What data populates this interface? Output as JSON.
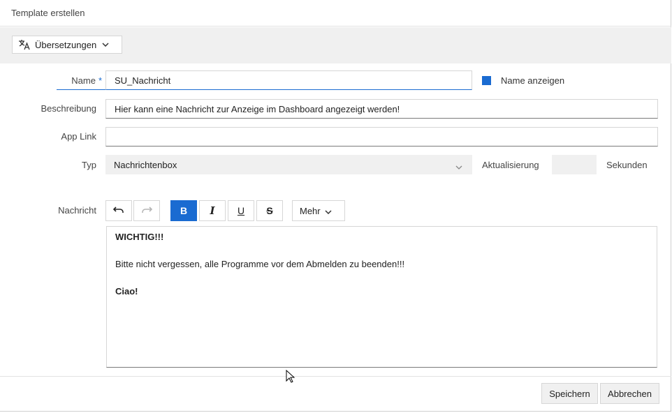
{
  "dialog": {
    "title": "Template erstellen"
  },
  "toolbar": {
    "translations_label": "Übersetzungen"
  },
  "form": {
    "name_label": "Name",
    "name_required_mark": "*",
    "name_value": "SU_Nachricht",
    "show_name_label": "Name anzeigen",
    "show_name_checked": true,
    "description_label": "Beschreibung",
    "description_value": "Hier kann eine Nachricht zur Anzeige im Dashboard angezeigt werden!",
    "app_link_label": "App Link",
    "app_link_value": "",
    "type_label": "Typ",
    "type_value": "Nachrichtenbox",
    "refresh_label": "Aktualisierung",
    "refresh_value": "",
    "seconds_label": "Sekunden",
    "message_label": "Nachricht"
  },
  "editor": {
    "toolbar": {
      "undo": "undo-icon",
      "redo": "redo-icon",
      "bold": "B",
      "italic": "I",
      "underline": "U",
      "strikethrough": "S",
      "more_label": "Mehr"
    },
    "content": {
      "line1": "WICHTIG!!!",
      "line2": "Bitte nicht vergessen, alle Programme vor dem Abmelden zu beenden!!!",
      "line3": "Ciao!"
    }
  },
  "footer": {
    "save_label": "Speichern",
    "cancel_label": "Abbrechen"
  },
  "colors": {
    "accent": "#1a6bd1",
    "band": "#f0f0f0"
  }
}
